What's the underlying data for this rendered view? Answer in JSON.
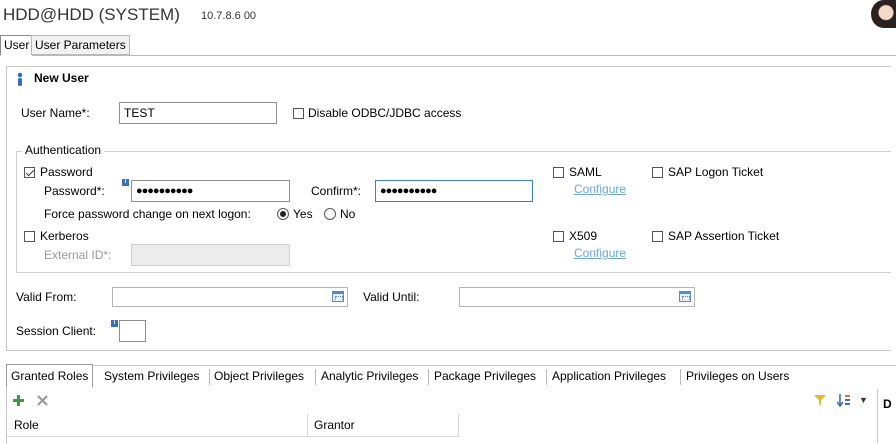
{
  "header": {
    "title": "HDD@HDD (SYSTEM)",
    "version": "10.7.8.6 00"
  },
  "editor_tabs": [
    "User",
    "User Parameters"
  ],
  "section_title": "New User",
  "user_name": {
    "label": "User Name*:",
    "value": "TEST"
  },
  "disable_odbc": {
    "label": "Disable ODBC/JDBC access",
    "checked": false
  },
  "authentication": {
    "title": "Authentication",
    "password": {
      "label": "Password",
      "checked": true,
      "password_label": "Password*:",
      "password_value": "●●●●●●●●●●",
      "confirm_label": "Confirm*:",
      "confirm_value": "●●●●●●●●●●",
      "force_label": "Force password change on next logon:",
      "yes_label": "Yes",
      "no_label": "No",
      "selected": "Yes"
    },
    "kerberos": {
      "label": "Kerberos",
      "checked": false,
      "external_id_label": "External ID*:",
      "external_id_value": ""
    },
    "saml": {
      "label": "SAML",
      "checked": false,
      "configure": "Configure"
    },
    "x509": {
      "label": "X509",
      "checked": false,
      "configure": "Configure"
    },
    "sap_logon_ticket": {
      "label": "SAP Logon Ticket",
      "checked": false
    },
    "sap_assertion_ticket": {
      "label": "SAP Assertion Ticket",
      "checked": false
    }
  },
  "valid_from": {
    "label": "Valid From:",
    "value": ""
  },
  "valid_until": {
    "label": "Valid Until:",
    "value": ""
  },
  "session_client": {
    "label": "Session Client:",
    "value": ""
  },
  "privilege_tabs": [
    "Granted Roles",
    "System Privileges",
    "Object Privileges",
    "Analytic Privileges",
    "Package Privileges",
    "Application Privileges",
    "Privileges on Users"
  ],
  "table": {
    "columns": [
      "Role",
      "Grantor"
    ],
    "side_header": "D"
  },
  "colors": {
    "link": "#6aa6e8",
    "focus_border": "#3a7bd5",
    "add_icon": "#3c9a3c"
  }
}
